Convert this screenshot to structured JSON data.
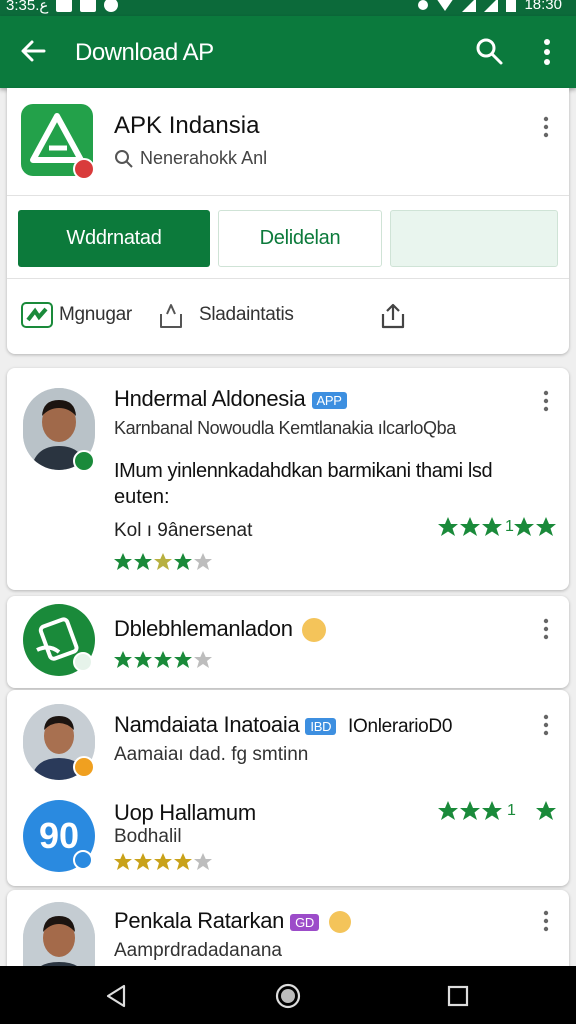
{
  "status_bar": {
    "time_left": "3:ع.35",
    "time_right": "18:30"
  },
  "app_bar": {
    "title": "Download AP"
  },
  "app_header": {
    "name": "APK Indansia",
    "developer": "Nenerahokk Anl",
    "buttons": {
      "install": "Wddrnatad",
      "details": "Delidelan"
    },
    "actions": {
      "first": "Mgnugar",
      "second": "Sladaintatis"
    }
  },
  "reviews": [
    {
      "title": "Hndermal Aldonesia",
      "tag": "APP",
      "subtitle": "Karnbanal Nowoudla Kemtlanakia ılcarloQba",
      "body_line1": "IMum yinlennkadahdkan barmikani thami lsd",
      "body_line2": "euten:",
      "footer": "Kol ı 9ânersenat",
      "right_rating_text": "1"
    },
    {
      "title": "Dblebhlemanladon"
    },
    {
      "title": "Namdaiata Inatoaia",
      "tag": "IBD",
      "extra": "IOnlerarioD0",
      "subtitle": "Aamaiaı dad. fg smtinn",
      "inner_title": "Uop Hallamum",
      "inner_subtitle": "Bodhalil",
      "inner_icon_text": "90",
      "right_rating_text": "1"
    },
    {
      "title": "Penkala Ratarkan",
      "tag": "GD",
      "subtitle": "Aamprdradadanana"
    }
  ],
  "colors": {
    "primary": "#0b7a3d",
    "star_green": "#1a8a3a",
    "star_gray": "#bdbdbd",
    "tag_blue": "#3d8fe0",
    "tag_purple": "#9c4cc9",
    "accent_orange": "#f0a020"
  },
  "icons": [
    "back-arrow-icon",
    "search-icon",
    "more-vert-icon",
    "app-logo-icon",
    "verified-badge-icon",
    "magnifier-icon",
    "green-app-icon",
    "bookmark-icon",
    "share-icon",
    "star-icon",
    "emoji-icon",
    "nav-back-icon",
    "nav-home-icon",
    "nav-recents-icon"
  ]
}
